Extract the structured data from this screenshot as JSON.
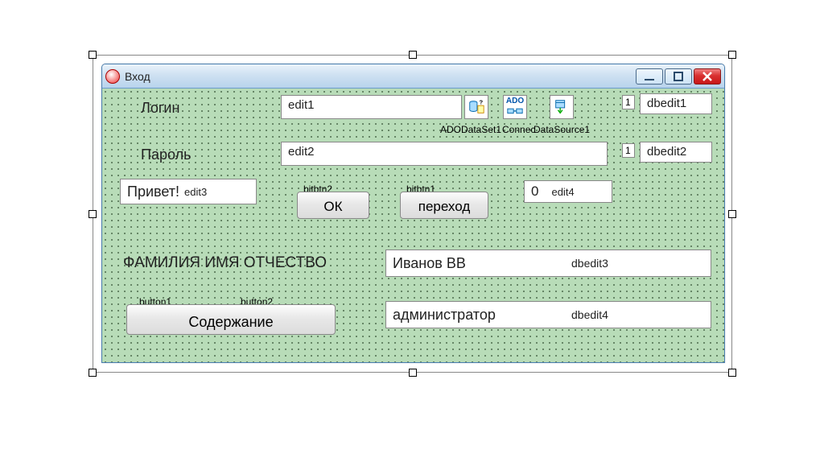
{
  "window": {
    "title": "Вход"
  },
  "labels": {
    "login": "Логин",
    "password": "Пароль",
    "greeting": "Привет!",
    "fio": "ФАМИЛИЯ ИМЯ ОТЧЕСТВО"
  },
  "edits": {
    "edit1": "edit1",
    "edit2": "edit2",
    "edit3": "edit3",
    "edit4_zero": "0",
    "edit4_name": "edit4"
  },
  "dbedits": {
    "dbedit1_num": "1",
    "dbedit1": "dbedit1",
    "dbedit2_num": "1",
    "dbedit2": "dbedit2",
    "dbedit3_val": "Иванов ВВ",
    "dbedit3_name": "dbedit3",
    "dbedit4_val": "администратор",
    "dbedit4_name": "dbedit4"
  },
  "buttons": {
    "bitbtn2_name": "bitbtn2",
    "bitbtn2_label": "ОК",
    "bitbtn1_name": "bitbtn1",
    "bitbtn1_label": "переход",
    "button1_name": "button1",
    "button2_name": "button2",
    "button_content": "Содержание"
  },
  "components": {
    "ado_dataset": "ADODataSet1",
    "ado_connec": "Connec",
    "datasource": "DataSource1",
    "ado_text": "ADO"
  }
}
